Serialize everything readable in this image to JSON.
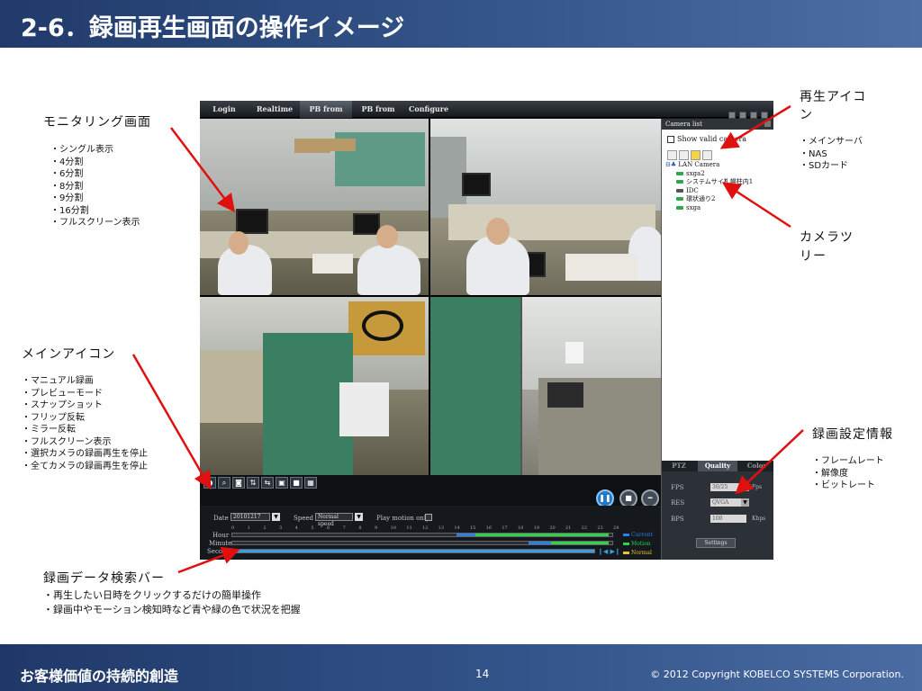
{
  "slide": {
    "title": "2-6．録画再生画面の操作イメージ",
    "footer_tagline": "お客様価値の持続的創造",
    "page_number": "14",
    "copyright": "©  2012 Copyright  KOBELCO SYSTEMS Corporation."
  },
  "annotations": {
    "monitoring": {
      "heading": "モニタリング画面",
      "items": [
        "・シングル表示",
        "・4分割",
        "・6分割",
        "・8分割",
        "・9分割",
        "・16分割",
        "・フルスクリーン表示"
      ]
    },
    "main_icons": {
      "heading": "メインアイコン",
      "items": [
        "・マニュアル録画",
        "・プレビューモード",
        "・スナップショット",
        "・フリップ反転",
        "・ミラー反転",
        "・フルスクリーン表示",
        "・選択カメラの録画再生を停止",
        "・全てカメラの録画再生を停止"
      ]
    },
    "search_bar": {
      "heading": "録画データ検索バー",
      "items": [
        "・再生したい日時をクリックするだけの簡単操作",
        "・録画中やモーション検知時など青や緑の色で状況を把握"
      ]
    },
    "playback_icon": {
      "heading_line1": "再生アイコ",
      "heading_line2": "ン",
      "items": [
        "・メインサーバ",
        "・NAS",
        "・SDカード"
      ]
    },
    "camera_tree": {
      "heading_line1": "カメラツ",
      "heading_line2": "リー"
    },
    "rec_settings": {
      "heading": "録画設定情報",
      "items": [
        "・フレームレート",
        "・解像度",
        "・ビットレート"
      ]
    }
  },
  "app": {
    "tabs": [
      "Login",
      "Realtime",
      "PB from server",
      "PB from local",
      "Configure"
    ],
    "active_tab": "PB from server",
    "camera_list": {
      "title": "Camera list",
      "show_valid_label": "Show valid camera",
      "root": "LAN Camera",
      "cameras": [
        "sxga2",
        "システムサイ札幌柱内1",
        "IDC",
        "環状通り2",
        "sxga"
      ]
    },
    "settings": {
      "tabs": [
        "PTZ",
        "Quality",
        "Color"
      ],
      "active_tab": "Quality",
      "fps_label": "FPS",
      "fps_value": "30/25",
      "fps_unit": "Fps",
      "res_label": "RES",
      "res_value": "QVGA",
      "bps_label": "BPS",
      "bps_value": "100",
      "bps_unit": "Kbps",
      "button": "Settings"
    },
    "search": {
      "date_label": "Date",
      "date_value": "20101217",
      "speed_label": "Speed",
      "speed_value": "Normal speed",
      "motion_label": "Play motion only",
      "hour_label": "Hour",
      "minute_label": "Minute",
      "second_label": "Second",
      "hour_ticks": [
        "0",
        "1",
        "2",
        "3",
        "4",
        "5",
        "6",
        "7",
        "8",
        "9",
        "10",
        "11",
        "12",
        "13",
        "14",
        "15",
        "16",
        "17",
        "18",
        "19",
        "20",
        "21",
        "22",
        "23",
        "24"
      ],
      "legend": [
        "Current",
        "Motion",
        "Normal"
      ]
    },
    "colors": {
      "motion": "#2fd24a",
      "current": "#2f7fe0",
      "normal": "#e6c230",
      "arrow": "#e01010"
    }
  }
}
